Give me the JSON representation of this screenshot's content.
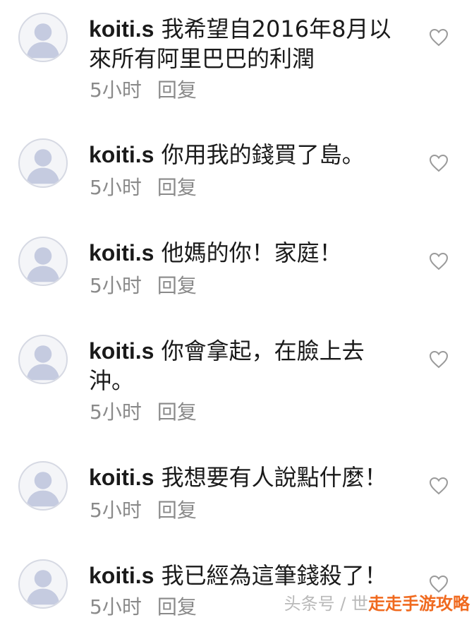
{
  "comments": [
    {
      "username": "koiti.s",
      "text": "我希望自2016年8月以來所有阿里巴巴的利潤",
      "time": "5小时",
      "reply": "回复"
    },
    {
      "username": "koiti.s",
      "text": "你用我的錢買了島。",
      "time": "5小时",
      "reply": "回复"
    },
    {
      "username": "koiti.s",
      "text": "他媽的你！家庭！",
      "time": "5小时",
      "reply": "回复"
    },
    {
      "username": "koiti.s",
      "text": "你會拿起，在臉上去沖。",
      "time": "5小时",
      "reply": "回复"
    },
    {
      "username": "koiti.s",
      "text": "我想要有人說點什麼！",
      "time": "5小时",
      "reply": "回复"
    },
    {
      "username": "koiti.s",
      "text": "我已經為這筆錢殺了！",
      "time": "5小时",
      "reply": "回复"
    }
  ],
  "icons": {
    "avatar": "default-user-avatar",
    "like": "heart-outline-icon"
  },
  "colors": {
    "text": "#1a1a1a",
    "meta": "#8a8a8a",
    "avatar_border": "#d6d9e3",
    "avatar_fill": "#c5cbe0",
    "watermark_accent": "#f06a1f"
  },
  "watermark": {
    "source": "头条号 / 世",
    "site": "走走手游攻略"
  }
}
